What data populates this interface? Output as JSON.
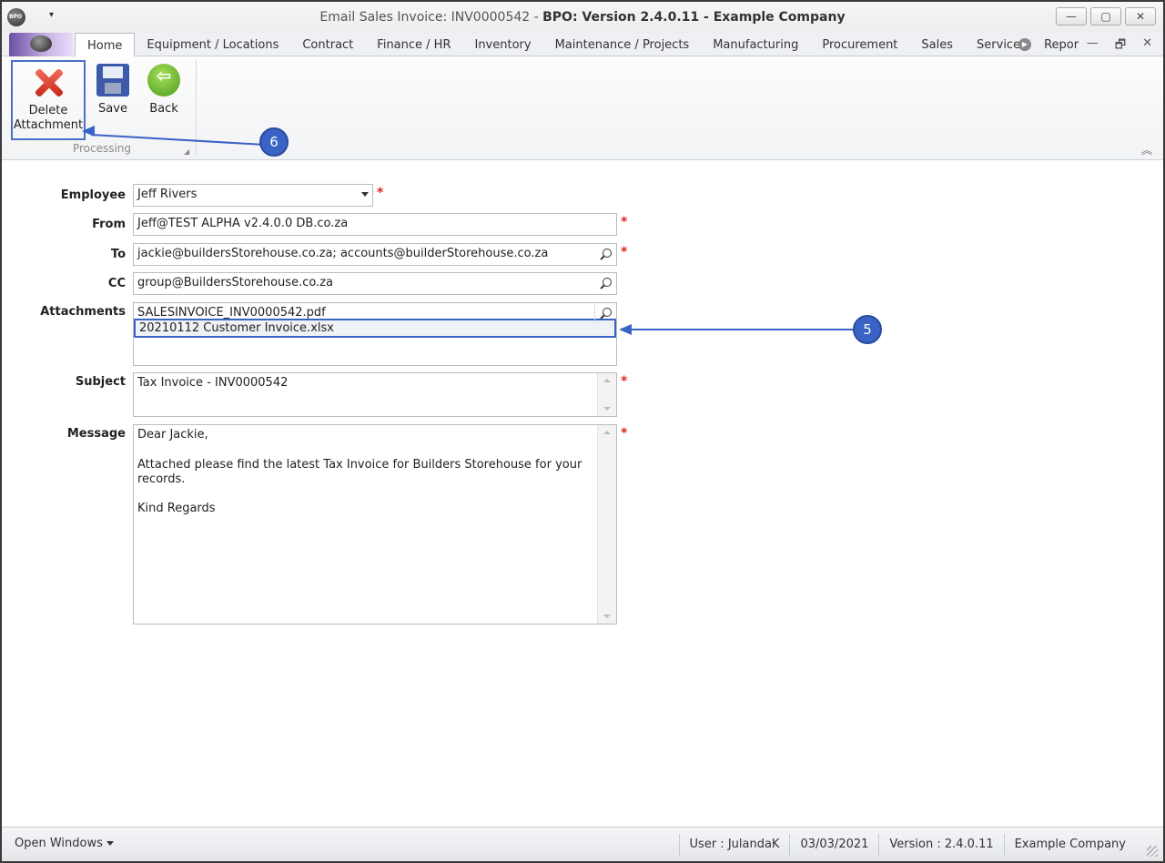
{
  "window": {
    "title_prefix": "Email Sales Invoice: INV0000542 - ",
    "title_bold": "BPO: Version 2.4.0.11 - Example Company",
    "minimize_glyph": "—",
    "maximize_glyph": "▢",
    "close_glyph": "✕",
    "qat_glyph": "▾"
  },
  "tabs": [
    {
      "label": "Home"
    },
    {
      "label": "Equipment / Locations"
    },
    {
      "label": "Contract"
    },
    {
      "label": "Finance / HR"
    },
    {
      "label": "Inventory"
    },
    {
      "label": "Maintenance / Projects"
    },
    {
      "label": "Manufacturing"
    },
    {
      "label": "Procurement"
    },
    {
      "label": "Sales"
    },
    {
      "label": "Service"
    },
    {
      "label": "Repor"
    }
  ],
  "mdi": {
    "minimize": "—",
    "restore": "🗗",
    "close": "✕"
  },
  "ribbon": {
    "delete_label_1": "Delete",
    "delete_label_2": "Attachment",
    "save_label": "Save",
    "back_label": "Back",
    "group_label": "Processing"
  },
  "callouts": {
    "c6": "6",
    "c5": "5"
  },
  "form": {
    "employee_label": "Employee",
    "employee_value": "Jeff Rivers",
    "from_label": "From",
    "from_value": "Jeff@TEST ALPHA v2.4.0.0 DB.co.za",
    "to_label": "To",
    "to_value": "jackie@buildersStorehouse.co.za; accounts@builderStorehouse.co.za",
    "cc_label": "CC",
    "cc_value": "group@BuildersStorehouse.co.za",
    "attachments_label": "Attachments",
    "attachments": [
      "SALESINVOICE_INV0000542.pdf",
      "20210112 Customer Invoice.xlsx"
    ],
    "subject_label": "Subject",
    "subject_value": "Tax Invoice - INV0000542",
    "message_label": "Message",
    "message_lines": [
      "Dear Jackie,",
      "",
      "Attached please find the latest Tax Invoice for Builders Storehouse for your",
      "records.",
      "",
      "Kind Regards"
    ],
    "required_mark": "*"
  },
  "statusbar": {
    "open_windows": "Open Windows",
    "user": "User : JulandaK",
    "date": "03/03/2021",
    "version": "Version : 2.4.0.11",
    "company": "Example Company"
  },
  "colors": {
    "callout": "#3a63c6",
    "required": "#e02020"
  }
}
